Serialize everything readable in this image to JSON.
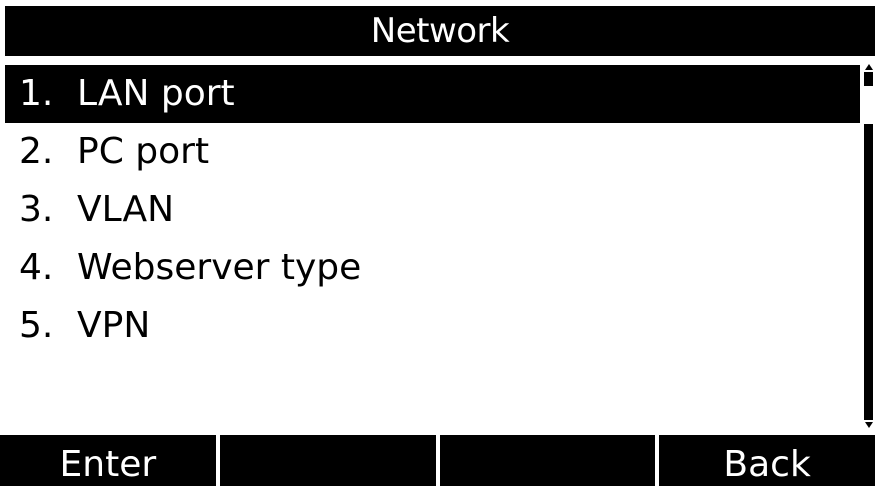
{
  "header": {
    "title": "Network"
  },
  "menu": {
    "items": [
      {
        "number": "1.",
        "label": "LAN port",
        "selected": true
      },
      {
        "number": "2.",
        "label": "PC port",
        "selected": false
      },
      {
        "number": "3.",
        "label": "VLAN",
        "selected": false
      },
      {
        "number": "4.",
        "label": "Webserver type",
        "selected": false
      },
      {
        "number": "5.",
        "label": "VPN",
        "selected": false
      }
    ]
  },
  "softkeys": {
    "key1": "Enter",
    "key2": "",
    "key3": "",
    "key4": "Back"
  },
  "colors": {
    "background": "#ffffff",
    "foreground": "#000000",
    "highlight_background": "#000000",
    "highlight_text": "#ffffff"
  }
}
